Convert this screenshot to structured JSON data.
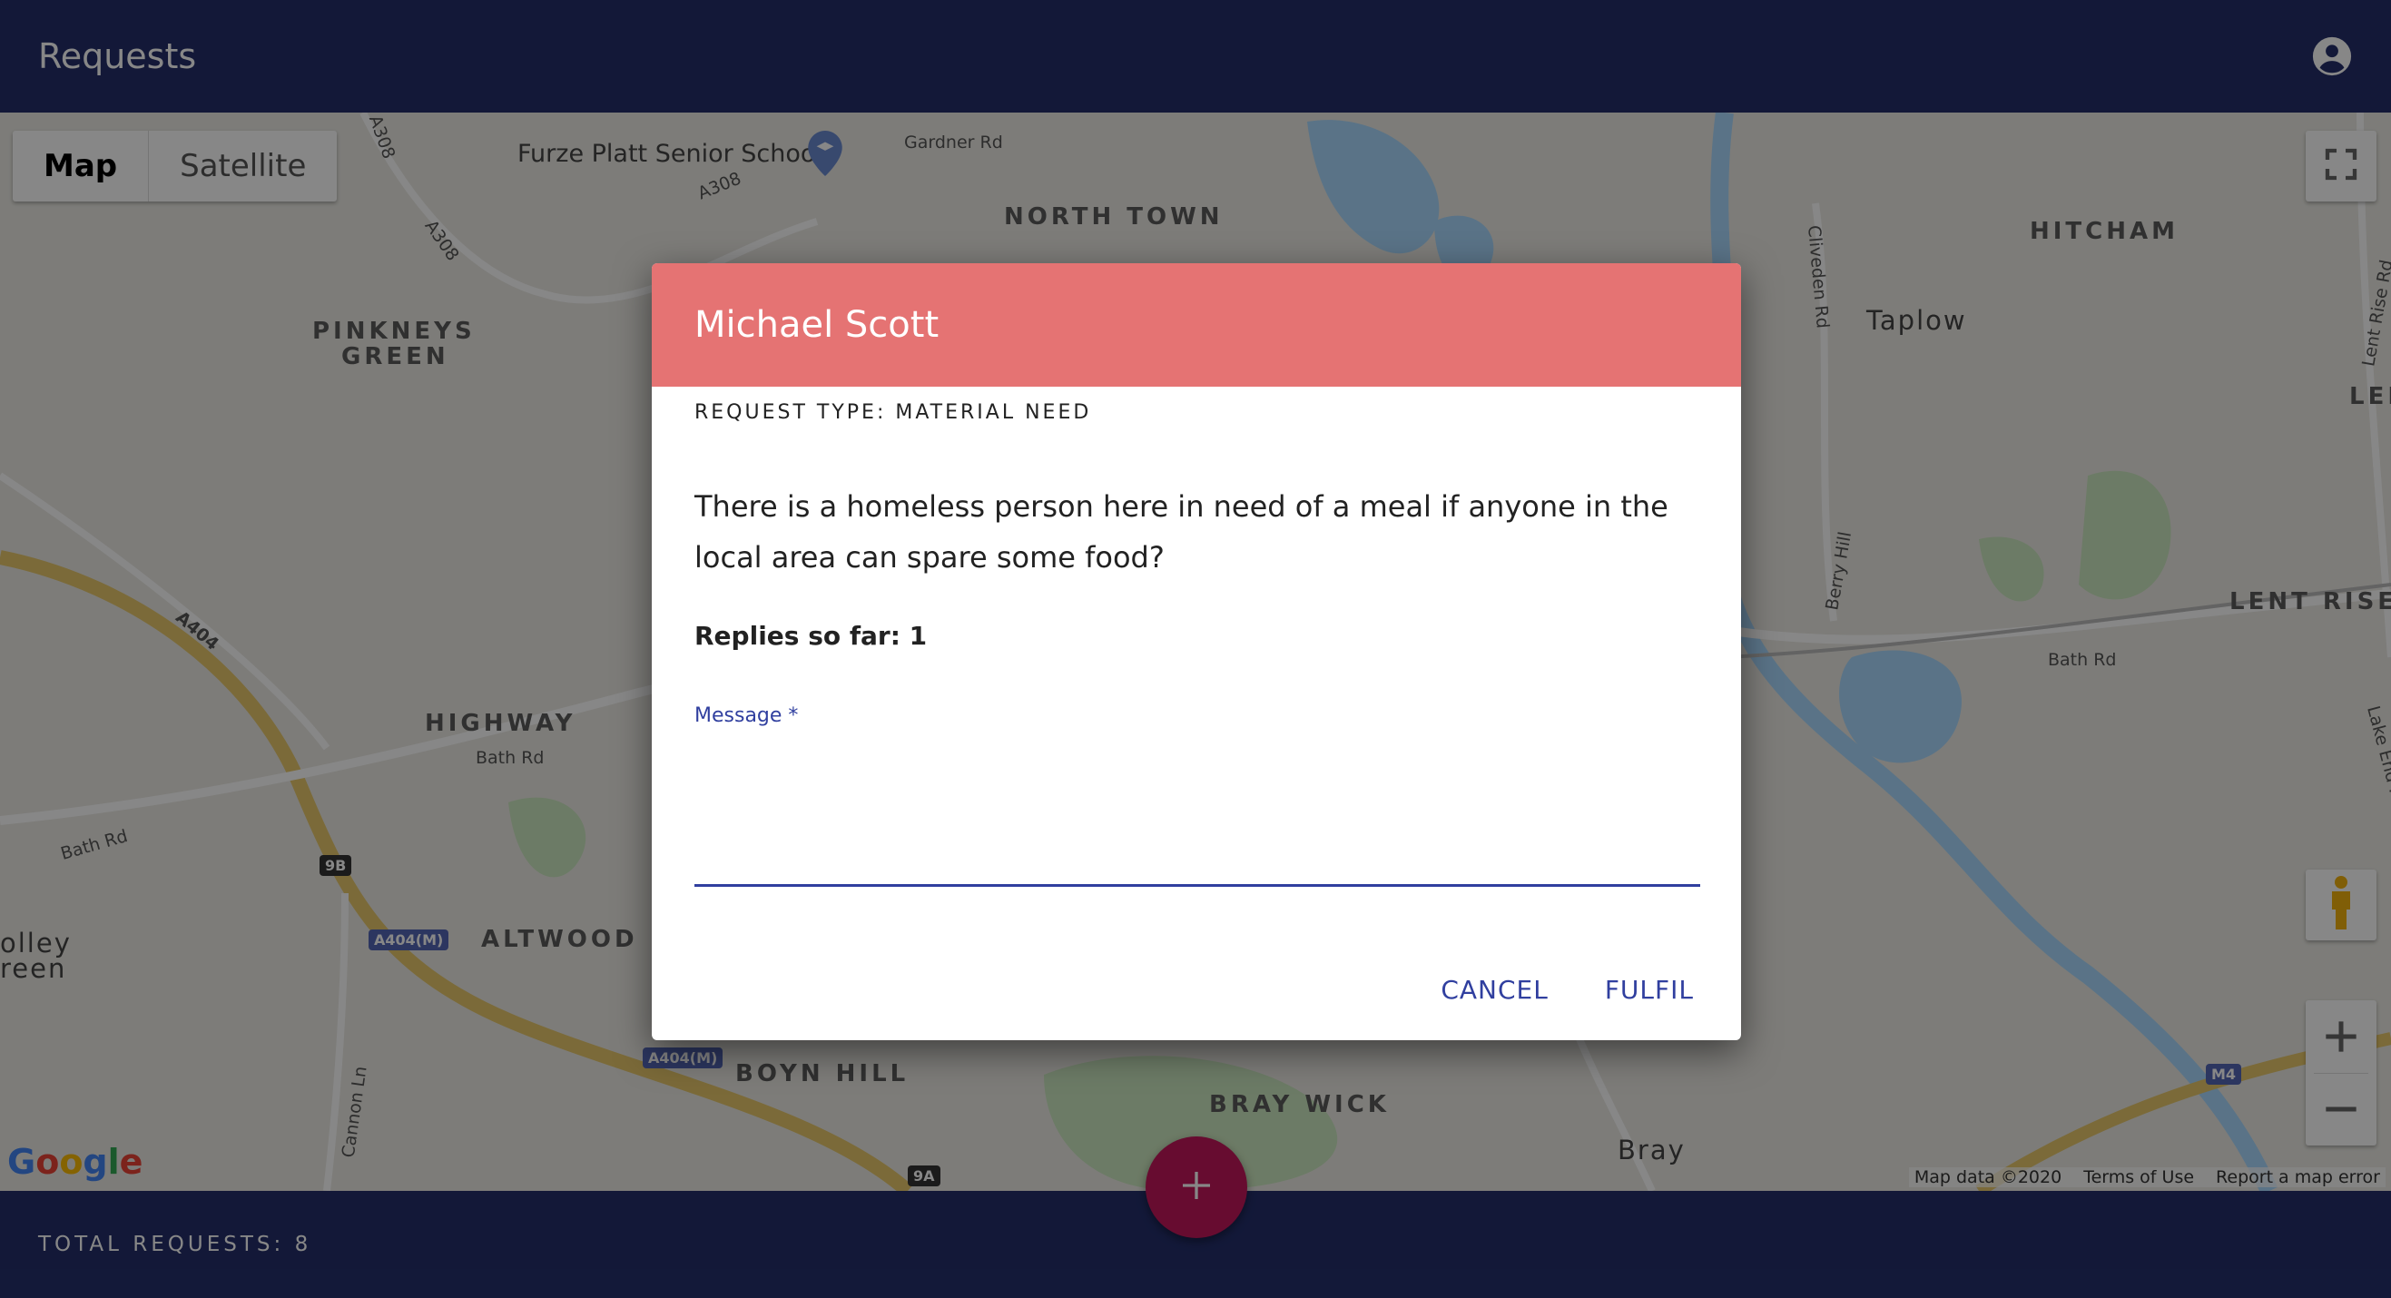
{
  "app": {
    "title": "Requests",
    "account_icon": "account-circle-icon"
  },
  "map": {
    "type_buttons": [
      "Map",
      "Satellite"
    ],
    "active_type": "Map",
    "labels": {
      "furze_platt": "Furze Platt Senior School",
      "gardner_rd": "Gardner Rd",
      "north_town": "NORTH TOWN",
      "hitcham": "HITCHAM",
      "pinkneys_1": "PINKNEYS",
      "pinkneys_2": "GREEN",
      "taplow": "Taplow",
      "highway": "HIGHWAY",
      "bath_rd_1": "Bath Rd",
      "bath_rd_2": "Bath Rd",
      "bath_rd_3": "Bath Rd",
      "altwood": "ALTWOOD",
      "boyn_hill": "BOYN HILL",
      "bray_wick": "BRAY WICK",
      "bray": "Bray",
      "lent_rise": "LENT RISE",
      "len": "LEN",
      "a404": "A404",
      "a308_1": "A308",
      "a308_2": "A308",
      "a308_3": "A308",
      "cliveden_rd": "Cliveden Rd",
      "berry_hill": "Berry Hill",
      "cannon_ln": "Cannon Ln",
      "lake_end_rd": "Lake End Rd",
      "lent_rise_rd": "Lent Rise Rd",
      "holley_1": "olley",
      "holley_2": "reen"
    },
    "shields": {
      "a404m_1": "A404(M)",
      "a404m_2": "A404(M)",
      "j9b": "9B",
      "j9a": "9A",
      "m4": "M4"
    },
    "google_logo": "Google",
    "attribution": [
      "Map data ©2020",
      "Terms of Use",
      "Report a map error"
    ]
  },
  "dialog": {
    "name": "Michael Scott",
    "request_type": "REQUEST TYPE: MATERIAL NEED",
    "description": "There is a homeless person here in need of a meal if anyone in the local area can spare some food?",
    "replies": "Replies so far: 1",
    "message_label": "Message *",
    "message_value": "",
    "cancel_label": "CANCEL",
    "fulfil_label": "FULFIL",
    "header_color": "#e57373"
  },
  "footer": {
    "total_requests": "TOTAL REQUESTS: 8"
  },
  "fab": {
    "icon": "plus-icon",
    "color": "#c2185b"
  },
  "colors": {
    "app_bar": "#242f6b",
    "accent": "#303f9f"
  }
}
